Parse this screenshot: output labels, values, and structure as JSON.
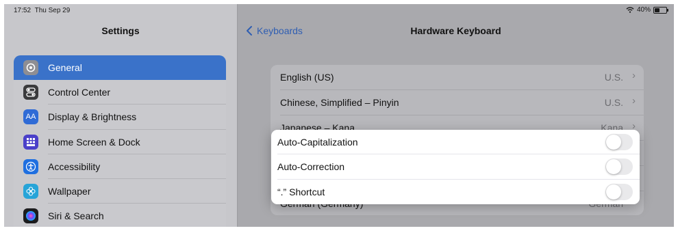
{
  "status_bar": {
    "time": "17:52",
    "date": "Thu Sep 29",
    "battery": "40%"
  },
  "sidebar": {
    "title": "Settings",
    "items": [
      {
        "label": "General",
        "icon": "gear-icon",
        "color": "#8e8e93",
        "selected": true
      },
      {
        "label": "Control Center",
        "icon": "toggles-icon",
        "color": "#3a3a3c"
      },
      {
        "label": "Display & Brightness",
        "icon": "text-size-icon",
        "color": "#2f6bd6"
      },
      {
        "label": "Home Screen & Dock",
        "icon": "grid-icon",
        "color": "#4a3fc9"
      },
      {
        "label": "Accessibility",
        "icon": "accessibility-icon",
        "color": "#1f6fe0"
      },
      {
        "label": "Wallpaper",
        "icon": "flower-icon",
        "color": "#27a4d8"
      },
      {
        "label": "Siri & Search",
        "icon": "siri-icon",
        "color": "#1c1c1e"
      }
    ]
  },
  "nav": {
    "back_label": "Keyboards",
    "title": "Hardware Keyboard"
  },
  "keyboards": [
    {
      "label": "English (US)",
      "value": "U.S."
    },
    {
      "label": "Chinese, Simplified – Pinyin",
      "value": "U.S."
    },
    {
      "label": "Japanese – Kana",
      "value": "Kana"
    },
    {
      "label": "",
      "value": ""
    },
    {
      "label": "",
      "value": ""
    },
    {
      "label": "German (Germany)",
      "value": "German"
    }
  ],
  "popup": {
    "items": [
      {
        "label": "Auto-Capitalization",
        "on": false
      },
      {
        "label": "Auto-Correction",
        "on": false
      },
      {
        "label": "“.” Shortcut",
        "on": false
      }
    ]
  },
  "colors": {
    "accent": "#3a72c9",
    "link": "#2f5eb2"
  }
}
